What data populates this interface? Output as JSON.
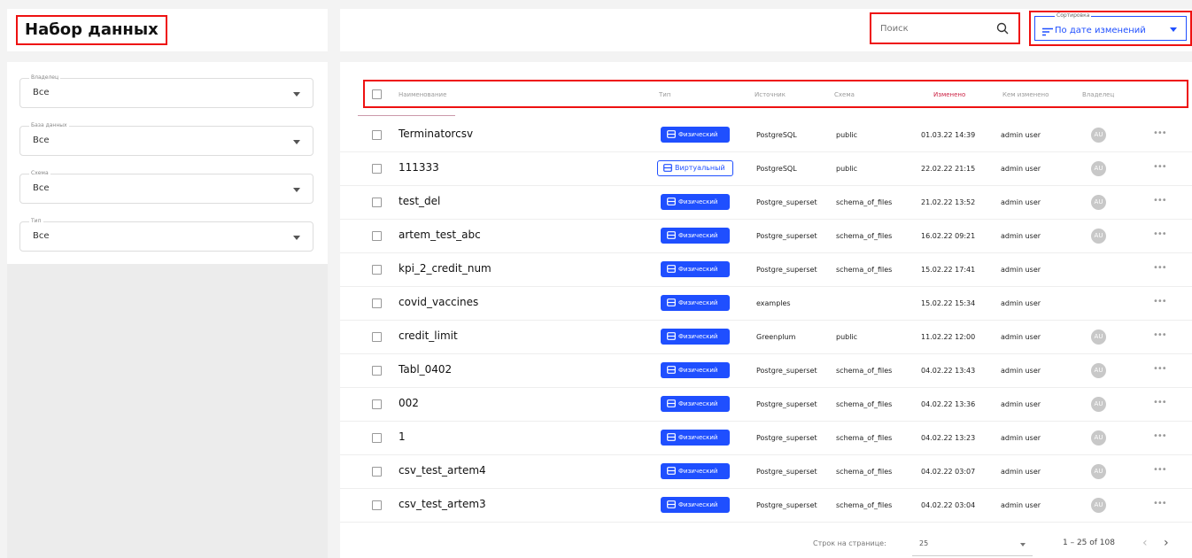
{
  "header": {
    "title": "Набор данных",
    "search_placeholder": "Поиск",
    "sort_legend": "Сортировка",
    "sort_value": "По дате изменений"
  },
  "filters": [
    {
      "label": "Владелец",
      "value": "Все"
    },
    {
      "label": "База данных",
      "value": "Все"
    },
    {
      "label": "Схема",
      "value": "Все"
    },
    {
      "label": "Тип",
      "value": "Все"
    }
  ],
  "table": {
    "columns": [
      "Наименование",
      "Тип",
      "Источник",
      "Схема",
      "Изменено",
      "Кем изменено",
      "Владелец"
    ],
    "rows": [
      {
        "name": "Terminatorcsv",
        "type": "Физический",
        "source": "PostgreSQL",
        "schema": "public",
        "modified": "01.03.22 14:39",
        "modified_by": "admin user",
        "owner": "AU"
      },
      {
        "name": "111333",
        "type": "Виртуальный",
        "source": "PostgreSQL",
        "schema": "public",
        "modified": "22.02.22 21:15",
        "modified_by": "admin user",
        "owner": "AU"
      },
      {
        "name": "test_del",
        "type": "Физический",
        "source": "Postgre_superset",
        "schema": "schema_of_files",
        "modified": "21.02.22 13:52",
        "modified_by": "admin user",
        "owner": "AU"
      },
      {
        "name": "artem_test_abc",
        "type": "Физический",
        "source": "Postgre_superset",
        "schema": "schema_of_files",
        "modified": "16.02.22 09:21",
        "modified_by": "admin user",
        "owner": "AU"
      },
      {
        "name": "kpi_2_credit_num",
        "type": "Физический",
        "source": "Postgre_superset",
        "schema": "schema_of_files",
        "modified": "15.02.22 17:41",
        "modified_by": "admin user",
        "owner": ""
      },
      {
        "name": "covid_vaccines",
        "type": "Физический",
        "source": "examples",
        "schema": "",
        "modified": "15.02.22 15:34",
        "modified_by": "admin user",
        "owner": ""
      },
      {
        "name": "credit_limit",
        "type": "Физический",
        "source": "Greenplum",
        "schema": "public",
        "modified": "11.02.22 12:00",
        "modified_by": "admin user",
        "owner": "AU"
      },
      {
        "name": "Tabl_0402",
        "type": "Физический",
        "source": "Postgre_superset",
        "schema": "schema_of_files",
        "modified": "04.02.22 13:43",
        "modified_by": "admin user",
        "owner": "AU"
      },
      {
        "name": "002",
        "type": "Физический",
        "source": "Postgre_superset",
        "schema": "schema_of_files",
        "modified": "04.02.22 13:36",
        "modified_by": "admin user",
        "owner": "AU"
      },
      {
        "name": "1",
        "type": "Физический",
        "source": "Postgre_superset",
        "schema": "schema_of_files",
        "modified": "04.02.22 13:23",
        "modified_by": "admin user",
        "owner": "AU"
      },
      {
        "name": "csv_test_artem4",
        "type": "Физический",
        "source": "Postgre_superset",
        "schema": "schema_of_files",
        "modified": "04.02.22 03:07",
        "modified_by": "admin user",
        "owner": "AU"
      },
      {
        "name": "csv_test_artem3",
        "type": "Физический",
        "source": "Postgre_superset",
        "schema": "schema_of_files",
        "modified": "04.02.22 03:04",
        "modified_by": "admin user",
        "owner": "AU"
      }
    ]
  },
  "footer": {
    "rows_per_page_label": "Строк на странице:",
    "rows_per_page_value": "25",
    "range": "1 – 25 of 108"
  },
  "colors": {
    "accent": "#1f4fff",
    "highlight": "#e11111"
  },
  "icons": {
    "search": "search-icon",
    "sort": "sort-lines-icon",
    "database": "database-icon",
    "more": "more-icon"
  }
}
